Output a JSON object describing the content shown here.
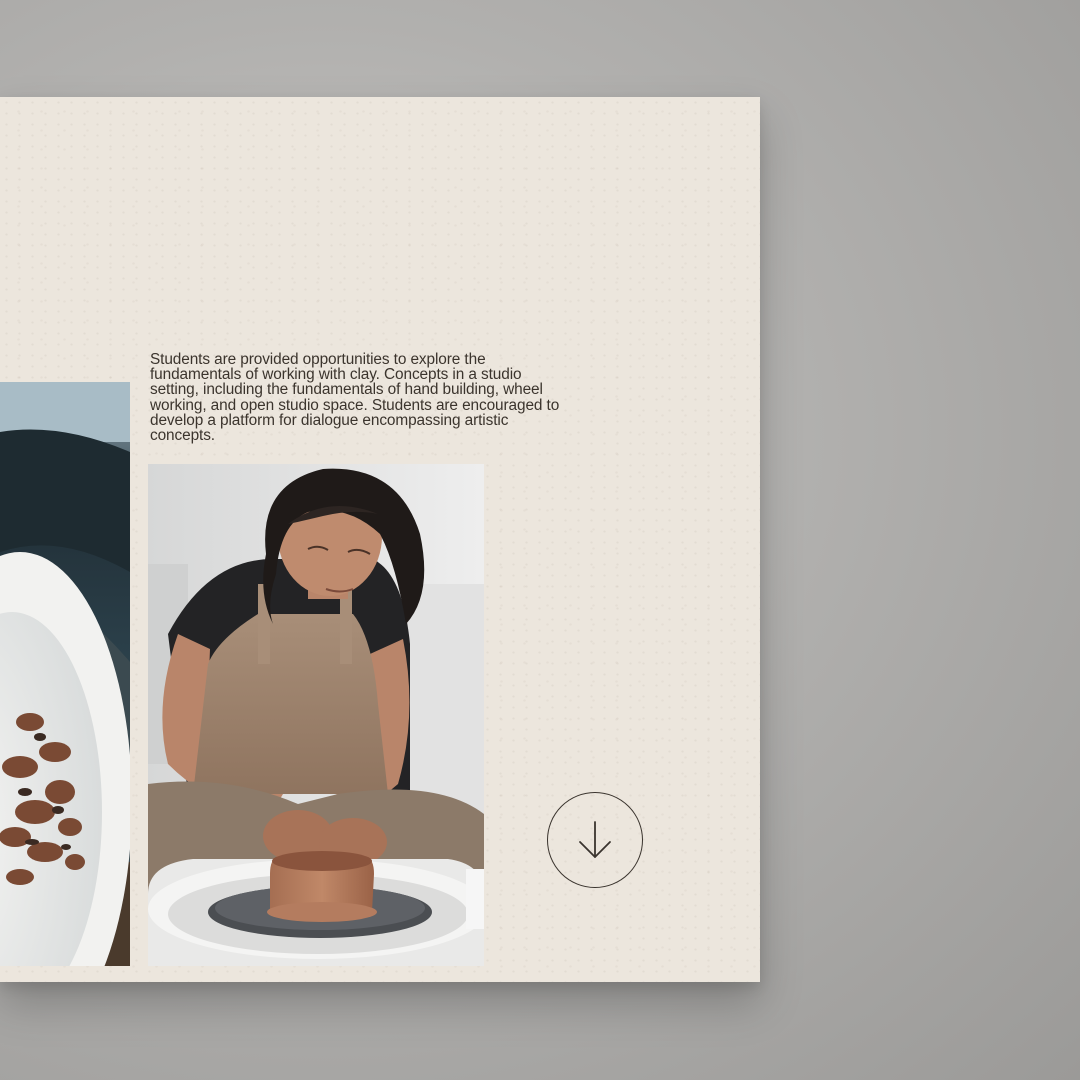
{
  "section": {
    "description": "Students are provided opportunities to explore the fundamentals of working with clay. Concepts in a studio setting, including the fundamentals of hand building, wheel working, and open studio space. Students are encouraged to develop a platform for dialogue encompassing artistic concepts."
  },
  "icons": {
    "scroll_down": "arrow-down-icon"
  },
  "colors": {
    "page_background": "#ece6dd",
    "backdrop": "#a9a8a6",
    "text": "#3b342d",
    "outline": "#3a342e"
  }
}
